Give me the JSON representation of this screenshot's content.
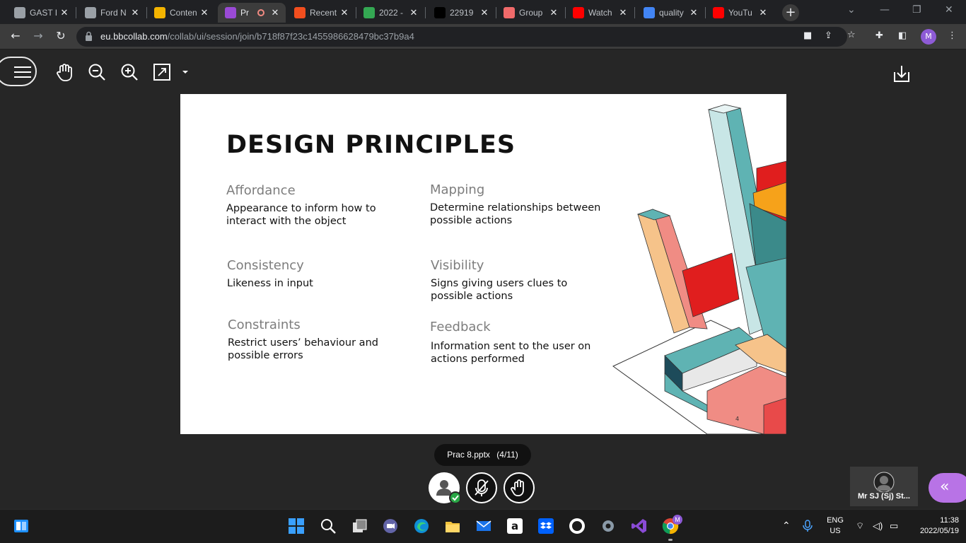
{
  "browser": {
    "tabs": [
      {
        "label": "GAST I",
        "color": "#9aa0a6"
      },
      {
        "label": "Ford N",
        "color": "#9aa0a6"
      },
      {
        "label": "Conten",
        "color": "#f4b400"
      },
      {
        "label": "Pr",
        "color": "#9a4ad6"
      },
      {
        "label": "Recent",
        "color": "#f24e1e"
      },
      {
        "label": "2022 -",
        "color": "#34a853"
      },
      {
        "label": "22919",
        "color": "#000000"
      },
      {
        "label": "Group",
        "color": "#f06a6a"
      },
      {
        "label": "Watch",
        "color": "#ff0000"
      },
      {
        "label": "quality",
        "color": "#4285f4"
      },
      {
        "label": "YouTu",
        "color": "#ff0000"
      }
    ],
    "url_host": "eu.bbcollab.com",
    "url_path": "/collab/ui/session/join/b718f87f23c1455986628479bc37b9a4",
    "profile_initial": "M"
  },
  "slide": {
    "title": "DESIGN PRINCIPLES",
    "page_number": "4",
    "principles": [
      {
        "heading": "Affordance",
        "text": "Appearance to inform how to interact with the object"
      },
      {
        "heading": "Mapping",
        "text": "Determine relationships between possible actions"
      },
      {
        "heading": "Consistency",
        "text": "Likeness in input"
      },
      {
        "heading": "Visibility",
        "text": "Signs giving users clues to possible actions"
      },
      {
        "heading": "Constraints",
        "text": "Restrict users’ behaviour and possible errors"
      },
      {
        "heading": "Feedback",
        "text": "Information sent to the user on actions performed"
      }
    ]
  },
  "session": {
    "file_name": "Prac 8.pptx",
    "file_page": "(4/11)",
    "participant_name": "Mr SJ (Sj) St..."
  },
  "taskbar": {
    "lang_top": "ENG",
    "lang_bottom": "US",
    "time": "11:38",
    "date": "2022/05/19",
    "chrome_badge": "M"
  },
  "colors": {
    "accent_purple": "#b873e6",
    "teal": "#5fb3b3",
    "salmon": "#f08c84",
    "red": "#e01e1e",
    "peach": "#f6c38a"
  }
}
